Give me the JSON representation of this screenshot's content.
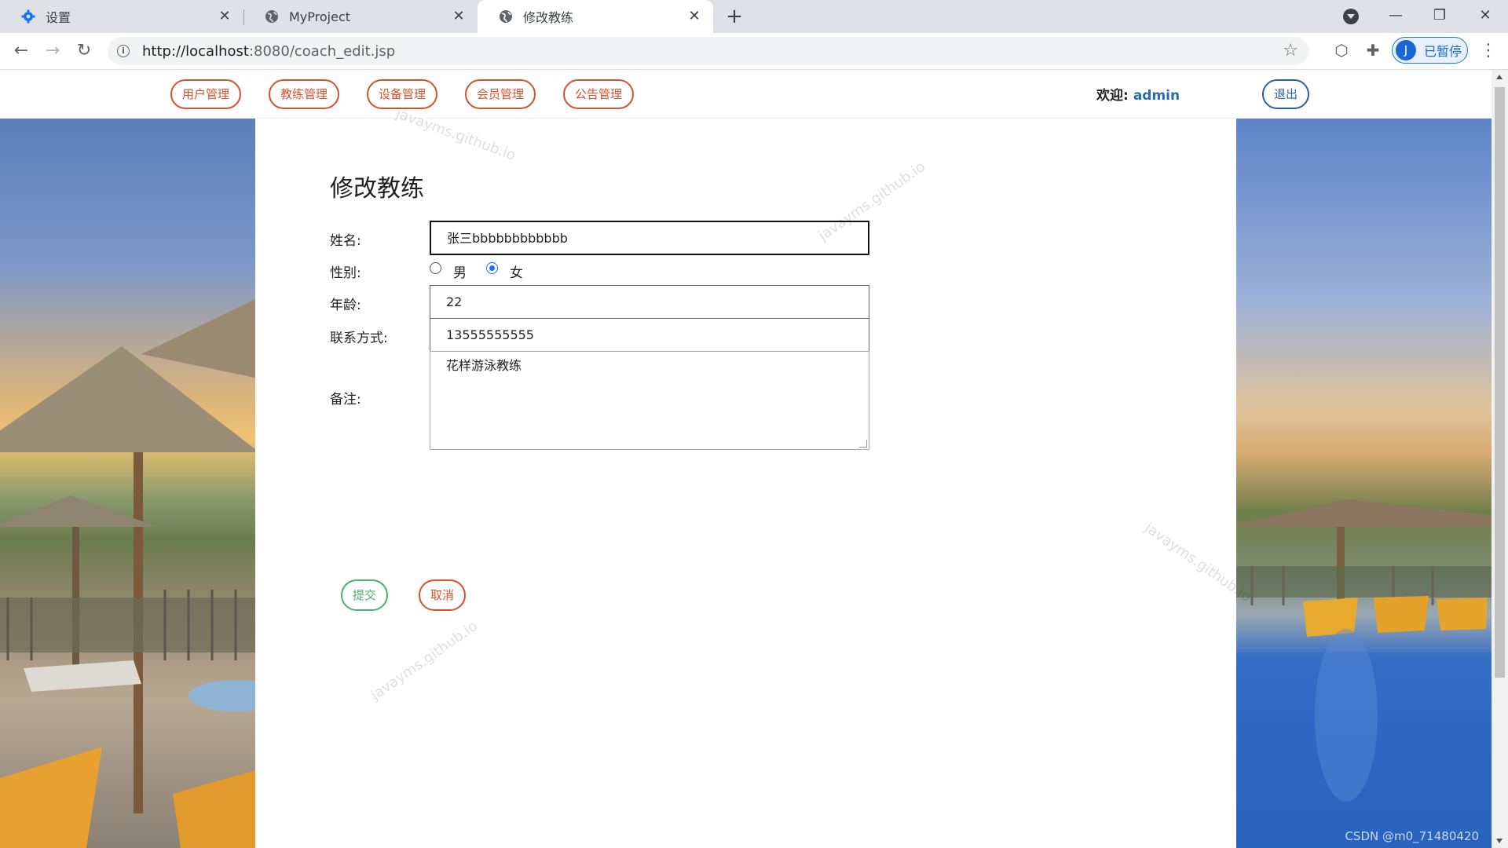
{
  "browser": {
    "tabs": [
      {
        "title": "设置",
        "icon": "gear-icon"
      },
      {
        "title": "MyProject",
        "icon": "globe-icon"
      },
      {
        "title": "修改教练",
        "icon": "globe-icon"
      }
    ],
    "url_host": "http://localhost",
    "url_rest": ":8080/coach_edit.jsp",
    "profile_initial": "J",
    "profile_label": "已暂停"
  },
  "nav": {
    "items": [
      "用户管理",
      "教练管理",
      "设备管理",
      "会员管理",
      "公告管理"
    ],
    "welcome_label": "欢迎:",
    "username": "admin",
    "logout": "退出"
  },
  "form": {
    "title": "修改教练",
    "name_label": "姓名:",
    "name_value": "张三bbbbbbbbbbbb",
    "gender_label": "性别:",
    "gender_options": [
      "男",
      "女"
    ],
    "gender_selected": "女",
    "age_label": "年龄:",
    "age_value": "22",
    "contact_label": "联系方式:",
    "contact_value": "13555555555",
    "remark_label": "备注:",
    "remark_value": "花样游泳教练",
    "submit": "提交",
    "cancel": "取消"
  },
  "watermark": "javayms.github.io",
  "footer_mark": "CSDN @m0_71480420",
  "colors": {
    "accent_orange": "#d4532f",
    "accent_green": "#4caf6e",
    "accent_blue": "#2a5ea8"
  }
}
